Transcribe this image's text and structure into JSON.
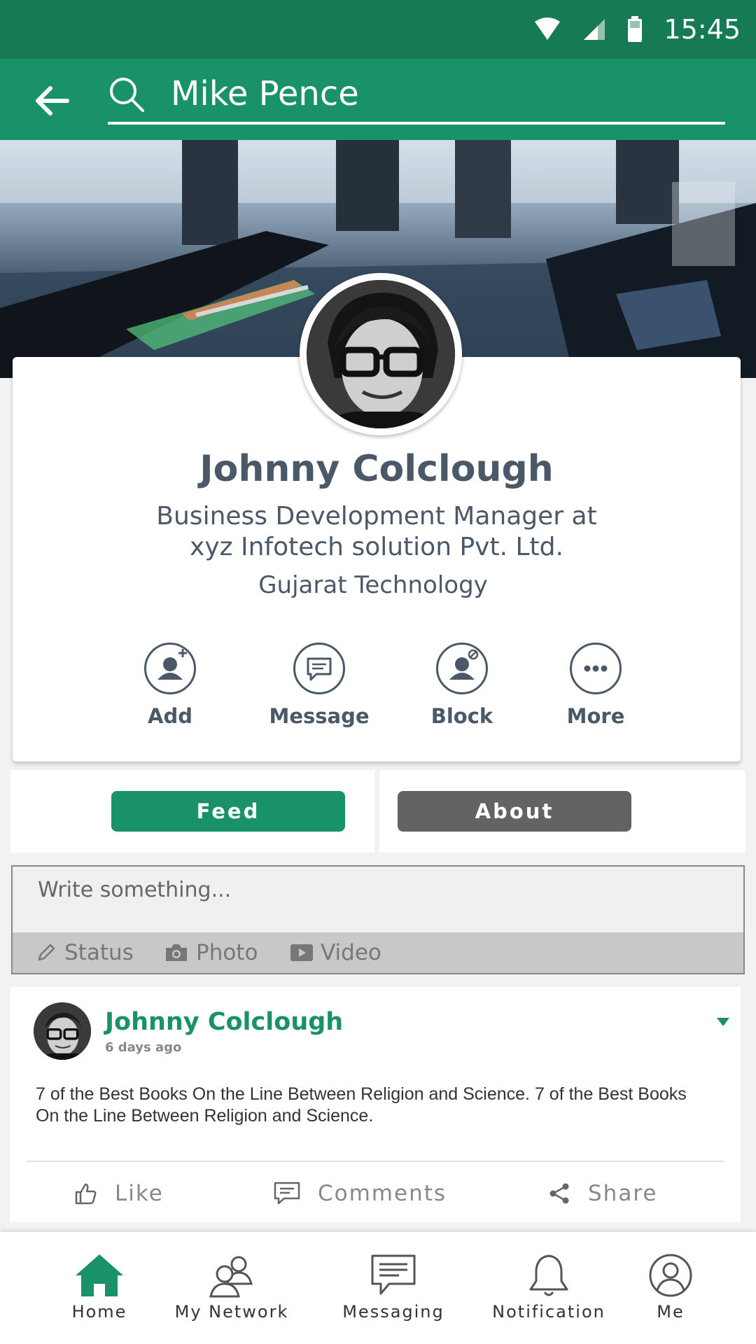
{
  "status_bar": {
    "time": "15:45"
  },
  "search": {
    "query": "Mike Pence"
  },
  "profile": {
    "name": "Johnny Colclough",
    "title_line1": "Business Development Manager at",
    "title_line2": "xyz Infotech solution Pvt. Ltd.",
    "company": "Gujarat Technology",
    "actions": [
      {
        "label": "Add",
        "icon": "add-user-icon"
      },
      {
        "label": "Message",
        "icon": "message-icon"
      },
      {
        "label": "Block",
        "icon": "block-user-icon"
      },
      {
        "label": "More",
        "icon": "more-icon"
      }
    ]
  },
  "tabs": {
    "feed_label": "Feed",
    "about_label": "About",
    "feed_color": "#1a9268",
    "about_color": "#636363"
  },
  "composer": {
    "placeholder": "Write something...",
    "status_label": "Status",
    "photo_label": "Photo",
    "video_label": "Video"
  },
  "post": {
    "author": "Johnny Colclough",
    "time": "6 days ago",
    "text": "7 of the Best Books On the Line Between Religion and Science. 7 of the Best Books On the Line Between Religion and Science.",
    "like_label": "Like",
    "comments_label": "Comments",
    "share_label": "Share"
  },
  "bottom_nav": {
    "items": [
      {
        "label": "Home",
        "icon": "home-icon",
        "active": true
      },
      {
        "label": "My Network",
        "icon": "network-icon"
      },
      {
        "label": "Messaging",
        "icon": "messaging-icon"
      },
      {
        "label": "Notification",
        "icon": "bell-icon"
      },
      {
        "label": "Me",
        "icon": "profile-icon"
      }
    ]
  },
  "colors": {
    "status_bar": "#167a54",
    "app_bar": "#1a9268",
    "accent": "#1a9268",
    "text": "#4a5868"
  }
}
